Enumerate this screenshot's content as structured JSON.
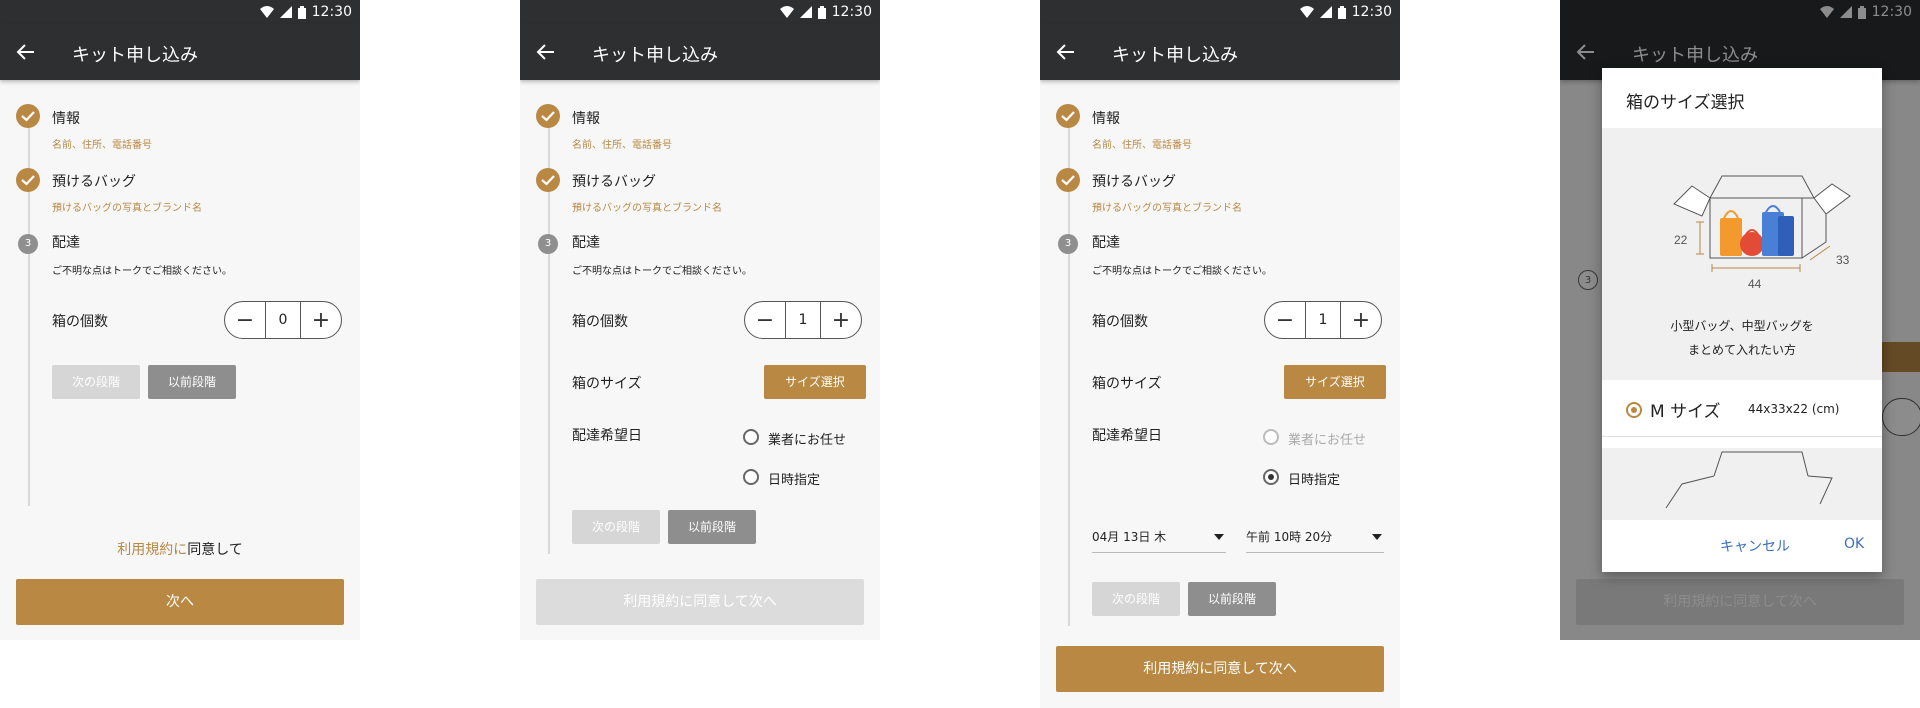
{
  "status": {
    "time": "12:30"
  },
  "app": {
    "title": "キット申し込み"
  },
  "steps": {
    "info": {
      "title": "情報",
      "sub": "名前、住所、電話番号"
    },
    "bag": {
      "title": "預けるバッグ",
      "sub": "預けるバッグの写真とブランド名"
    },
    "delivery": {
      "num": "3",
      "title": "配達",
      "note": "ご不明な点はトークでご相談ください。"
    }
  },
  "form": {
    "box_count_label": "箱の個数",
    "box_size_label": "箱のサイズ",
    "size_button": "サイズ選択",
    "delivery_date_label": "配達希望日",
    "option_carrier": "業者にお任せ",
    "option_datetime": "日時指定",
    "next_step": "次の段階",
    "prev_step": "以前段階",
    "minus": "−",
    "plus": "+"
  },
  "screens": {
    "s1": {
      "count": "0"
    },
    "s2": {
      "count": "1"
    },
    "s3": {
      "count": "1",
      "date": "04月 13日 木",
      "time": "午前 10時 20分"
    }
  },
  "footer": {
    "terms_link": "利用規約に",
    "terms_rest": "同意して",
    "next": "次へ",
    "agree_next": "利用規約に同意して次へ"
  },
  "dialog": {
    "title": "箱のサイズ選択",
    "dim_h": "22",
    "dim_w": "44",
    "dim_d": "33",
    "caption_1": "小型バッグ、中型バッグを",
    "caption_2": "まとめて入れたい方",
    "option_name": "M サイズ",
    "option_dims": "44x33x22 (cm)",
    "cancel": "キャンセル",
    "ok": "OK"
  },
  "colors": {
    "accent": "#b98944",
    "appbar": "#2d2f31",
    "link": "#3a6fbf"
  }
}
